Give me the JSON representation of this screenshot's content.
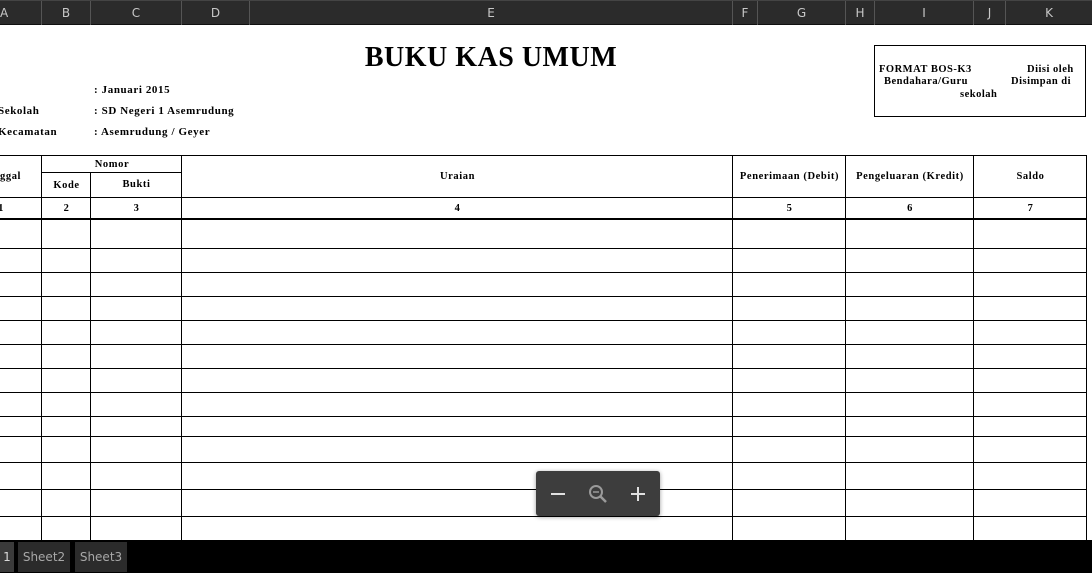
{
  "columns": [
    "A",
    "B",
    "C",
    "D",
    "E",
    "F",
    "G",
    "H",
    "I",
    "J",
    "K"
  ],
  "document": {
    "title": "BUKU KAS UMUM",
    "month_line": ": Januari 2015",
    "school_label": "Sekolah",
    "school_value": ": SD Negeri 1 Asemrudung",
    "district_label": "Kecamatan",
    "district_value": ": Asemrudung / Geyer",
    "format_box": {
      "line1_left": "FORMAT BOS-K3",
      "line1_right": "Diisi oleh",
      "line2_left": "Bendahara/Guru",
      "line2_right": "Disimpan di",
      "line3": "sekolah"
    }
  },
  "table": {
    "col_tanggal": "ggal",
    "group_nomor": "Nomor",
    "col_kode": "Kode",
    "col_bukti": "Bukti",
    "col_uraian": "Uraian",
    "col_penerimaan": "Penerimaan (Debit)",
    "col_pengeluaran": "Pengeluaran (Kredit)",
    "col_saldo": "Saldo",
    "numbers": [
      "1",
      "2",
      "3",
      "4",
      "5",
      "6",
      "7"
    ]
  },
  "tabs": [
    "1",
    "Sheet2",
    "Sheet3"
  ],
  "colors": {
    "header_bar": "#2b2b2b",
    "tab_bar": "#000000",
    "sheet": "#ffffff",
    "zoom_bg": "#3d3d3d"
  },
  "zoom_controls": {
    "minus_icon": "minus-icon",
    "magnifier_icon": "zoom-magnifier-icon",
    "plus_icon": "plus-icon"
  }
}
